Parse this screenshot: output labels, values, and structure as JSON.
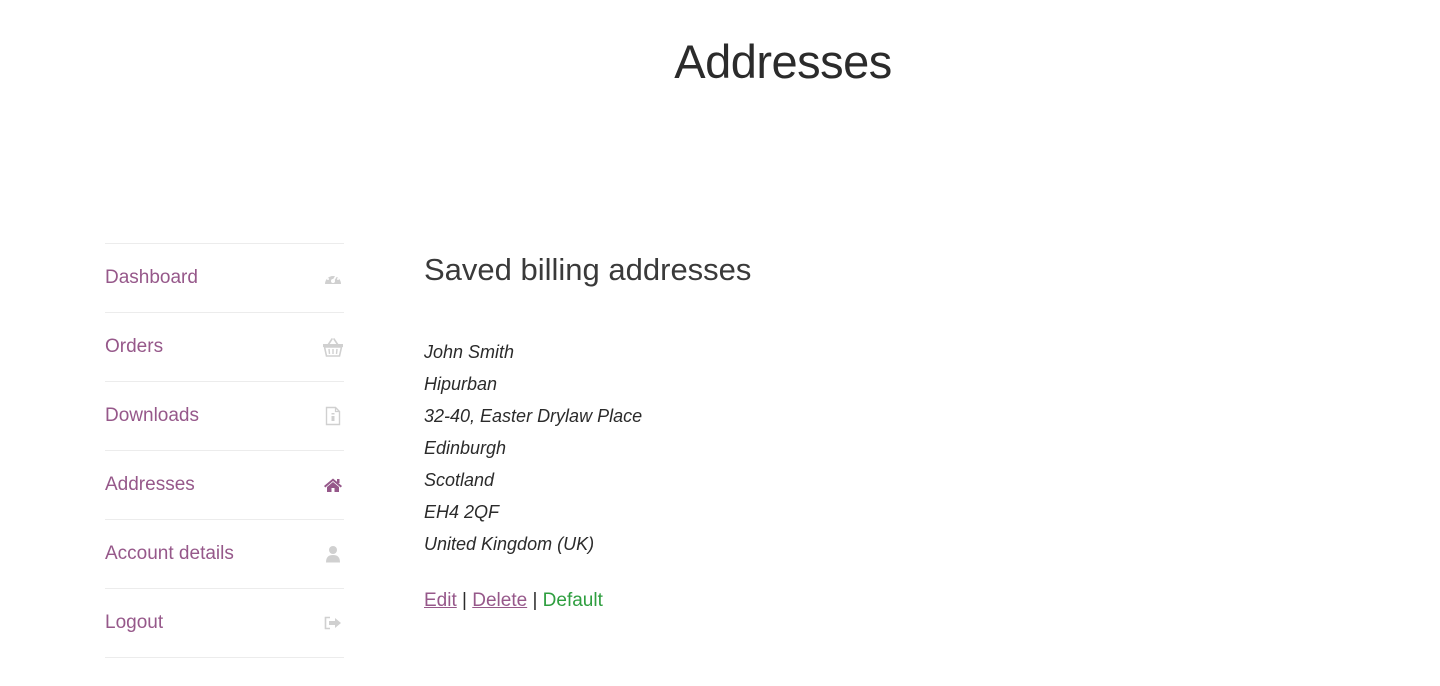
{
  "page": {
    "title": "Addresses"
  },
  "nav": {
    "items": [
      {
        "label": "Dashboard",
        "icon": "dashboard-icon",
        "active": false
      },
      {
        "label": "Orders",
        "icon": "basket-icon",
        "active": false
      },
      {
        "label": "Downloads",
        "icon": "file-icon",
        "active": false
      },
      {
        "label": "Addresses",
        "icon": "home-icon",
        "active": true
      },
      {
        "label": "Account details",
        "icon": "user-icon",
        "active": false
      },
      {
        "label": "Logout",
        "icon": "sign-out-icon",
        "active": false
      }
    ]
  },
  "main": {
    "section_title": "Saved billing addresses",
    "address_lines": [
      "John Smith",
      "Hipurban",
      "32-40, Easter Drylaw Place",
      "Edinburgh",
      "Scotland",
      "EH4 2QF",
      "United Kingdom (UK)"
    ],
    "actions": {
      "edit_label": "Edit",
      "delete_label": "Delete",
      "separator": "|",
      "default_label": "Default"
    }
  },
  "colors": {
    "link": "#96588a",
    "icon_inactive": "#d0d0d0",
    "icon_active": "#96588a",
    "default_badge": "#2e9e3f"
  }
}
